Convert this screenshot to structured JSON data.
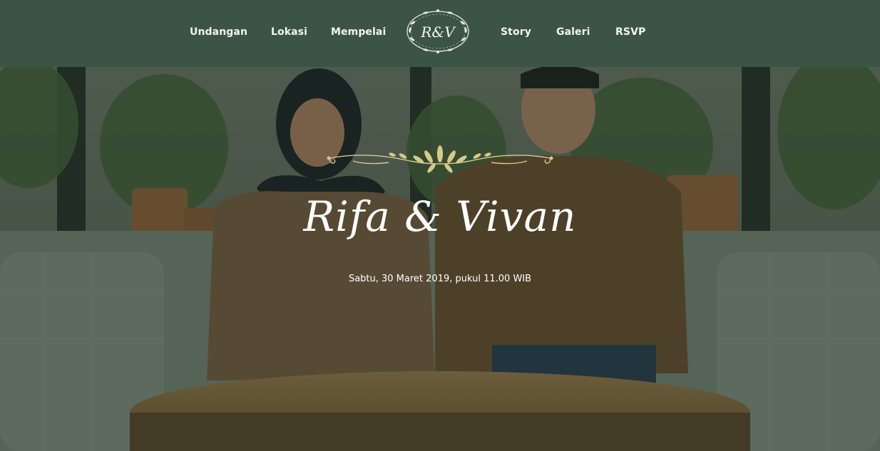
{
  "nav": {
    "items": [
      "Undangan",
      "Lokasi",
      "Mempelai",
      "Story",
      "Galeri",
      "RSVP"
    ],
    "logo_text": "R&V"
  },
  "hero": {
    "couple": "Rifa & Vivan",
    "date": "Sabtu, 30 Maret 2019, pukul 11.00 WIB"
  },
  "colors": {
    "nav_bg": "#3b5446",
    "ornament_gold": "#d8c98a",
    "text": "#ffffff"
  },
  "icons": [
    "logo-wreath-icon",
    "ornament-icon"
  ]
}
